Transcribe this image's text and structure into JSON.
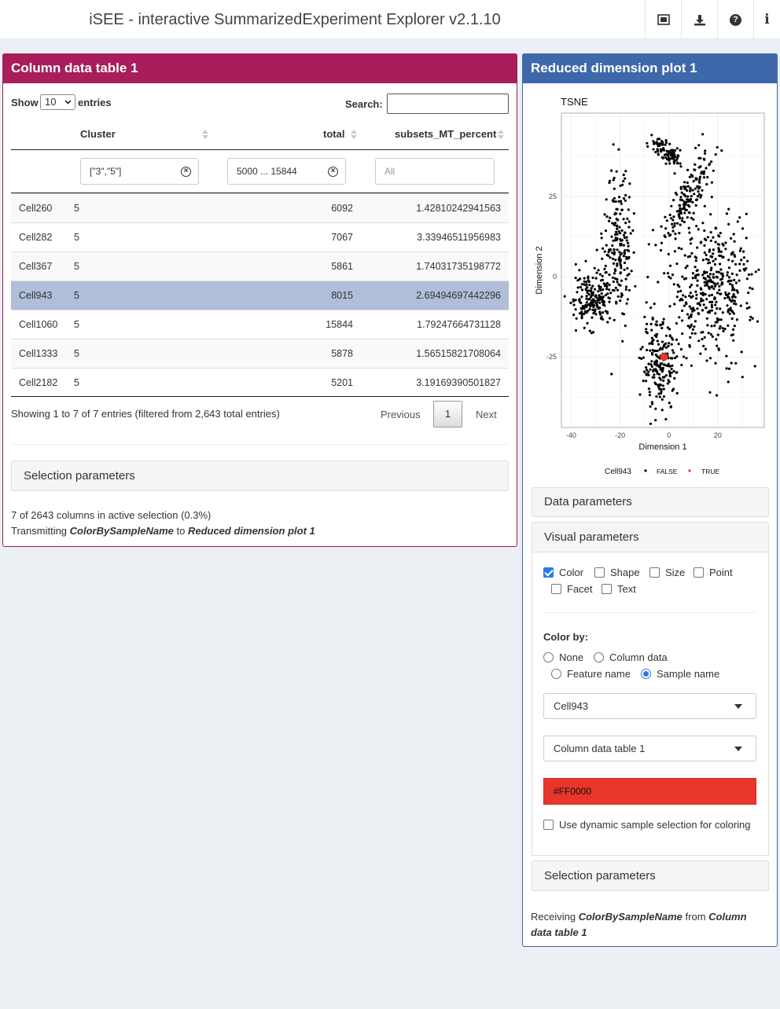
{
  "header": {
    "title": "iSEE - interactive SummarizedExperiment Explorer v2.1.10",
    "buttons": [
      "screenshot-icon",
      "download-icon",
      "help-icon",
      "info-icon"
    ],
    "help_glyph": "?",
    "info_glyph": "i"
  },
  "table_panel": {
    "title": "Column data table 1",
    "color": "#a81d5a",
    "show_label": "Show",
    "entries_value": "10",
    "entries_label": "entries",
    "search_label": "Search:",
    "columns": [
      "",
      "Cluster",
      "total",
      "subsets_MT_percent"
    ],
    "filters": {
      "cluster": "[\"3\",\"5\"]",
      "total": "5000 ... 15844",
      "subsets_placeholder": "All"
    },
    "rows": [
      [
        "Cell260",
        "5",
        "6092",
        "1.42810242941563"
      ],
      [
        "Cell282",
        "5",
        "7067",
        "3.33946511956983"
      ],
      [
        "Cell367",
        "5",
        "5861",
        "1.74031735198772"
      ],
      [
        "Cell943",
        "5",
        "8015",
        "2.69494697442296"
      ],
      [
        "Cell1060",
        "5",
        "15844",
        "1.79247664731128"
      ],
      [
        "Cell1333",
        "5",
        "5878",
        "1.56515821708064"
      ],
      [
        "Cell2182",
        "5",
        "5201",
        "3.19169390501827"
      ]
    ],
    "selected_row": "Cell943",
    "info": "Showing 1 to 7 of 7 entries (filtered from 2,643 total entries)",
    "pager": {
      "previous": "Previous",
      "page": "1",
      "next": "Next"
    },
    "selection_params": "Selection parameters",
    "summary": "7 of 2643 columns in active selection (0.3%)",
    "transmit_prefix": "Transmitting ",
    "transmit_var": "ColorBySampleName",
    "transmit_mid": " to ",
    "transmit_target": "Reduced dimension plot 1"
  },
  "plot_panel": {
    "title": "Reduced dimension plot 1",
    "color": "#3e68a9",
    "data_params": "Data parameters",
    "visual_params": "Visual parameters",
    "checkboxes": [
      {
        "label": "Color",
        "checked": true
      },
      {
        "label": "Shape",
        "checked": false
      },
      {
        "label": "Size",
        "checked": false
      },
      {
        "label": "Point",
        "checked": false
      },
      {
        "label": "Facet",
        "checked": false
      },
      {
        "label": "Text",
        "checked": false
      }
    ],
    "color_by_label": "Color by:",
    "color_by_options": [
      {
        "label": "None",
        "checked": false
      },
      {
        "label": "Column data",
        "checked": false
      },
      {
        "label": "Feature name",
        "checked": false
      },
      {
        "label": "Sample name",
        "checked": true
      }
    ],
    "sample_select": "Cell943",
    "table_select": "Column data table 1",
    "highlight_color": "#FF0000",
    "dynamic_label": "Use dynamic sample selection for coloring",
    "selection_params": "Selection parameters",
    "receive_prefix": "Receiving ",
    "receive_var": "ColorBySampleName",
    "receive_mid": " from ",
    "receive_source": "Column data table 1"
  },
  "chart_data": {
    "type": "scatter",
    "title": "TSNE",
    "xlabel": "Dimension 1",
    "ylabel": "Dimension 2",
    "xlim": [
      -44,
      39
    ],
    "ylim": [
      -47,
      51
    ],
    "x_ticks": [
      "-40",
      "-20",
      "0",
      "20"
    ],
    "y_ticks": [
      "25",
      "0",
      "-25"
    ],
    "legend": {
      "title": "Cell943",
      "entries": [
        "FALSE",
        "TRUE"
      ],
      "colors": [
        "#000000",
        "#e8372e"
      ],
      "position": "bottom"
    },
    "grid": true,
    "clusters": [
      {
        "name": "top arm",
        "cx": -4,
        "cy": 40,
        "sx": 4,
        "sy": 3,
        "n": 90
      },
      {
        "name": "upper diagonal",
        "cx": 8,
        "cy": 25,
        "sx": 4,
        "sy": 8,
        "n": 150
      },
      {
        "name": "right mass",
        "cx": 17,
        "cy": -4,
        "sx": 9,
        "sy": 11,
        "n": 420
      },
      {
        "name": "left vertical",
        "cx": -21,
        "cy": 11,
        "sx": 3,
        "sy": 11,
        "n": 190
      },
      {
        "name": "left lower",
        "cx": -32,
        "cy": -7,
        "sx": 5,
        "sy": 4,
        "n": 190
      },
      {
        "name": "bottom",
        "cx": -4,
        "cy": -28,
        "sx": 3.5,
        "sy": 7,
        "n": 200
      }
    ],
    "highlight_point": {
      "label": "Cell943",
      "x": -2,
      "y": -25
    }
  }
}
